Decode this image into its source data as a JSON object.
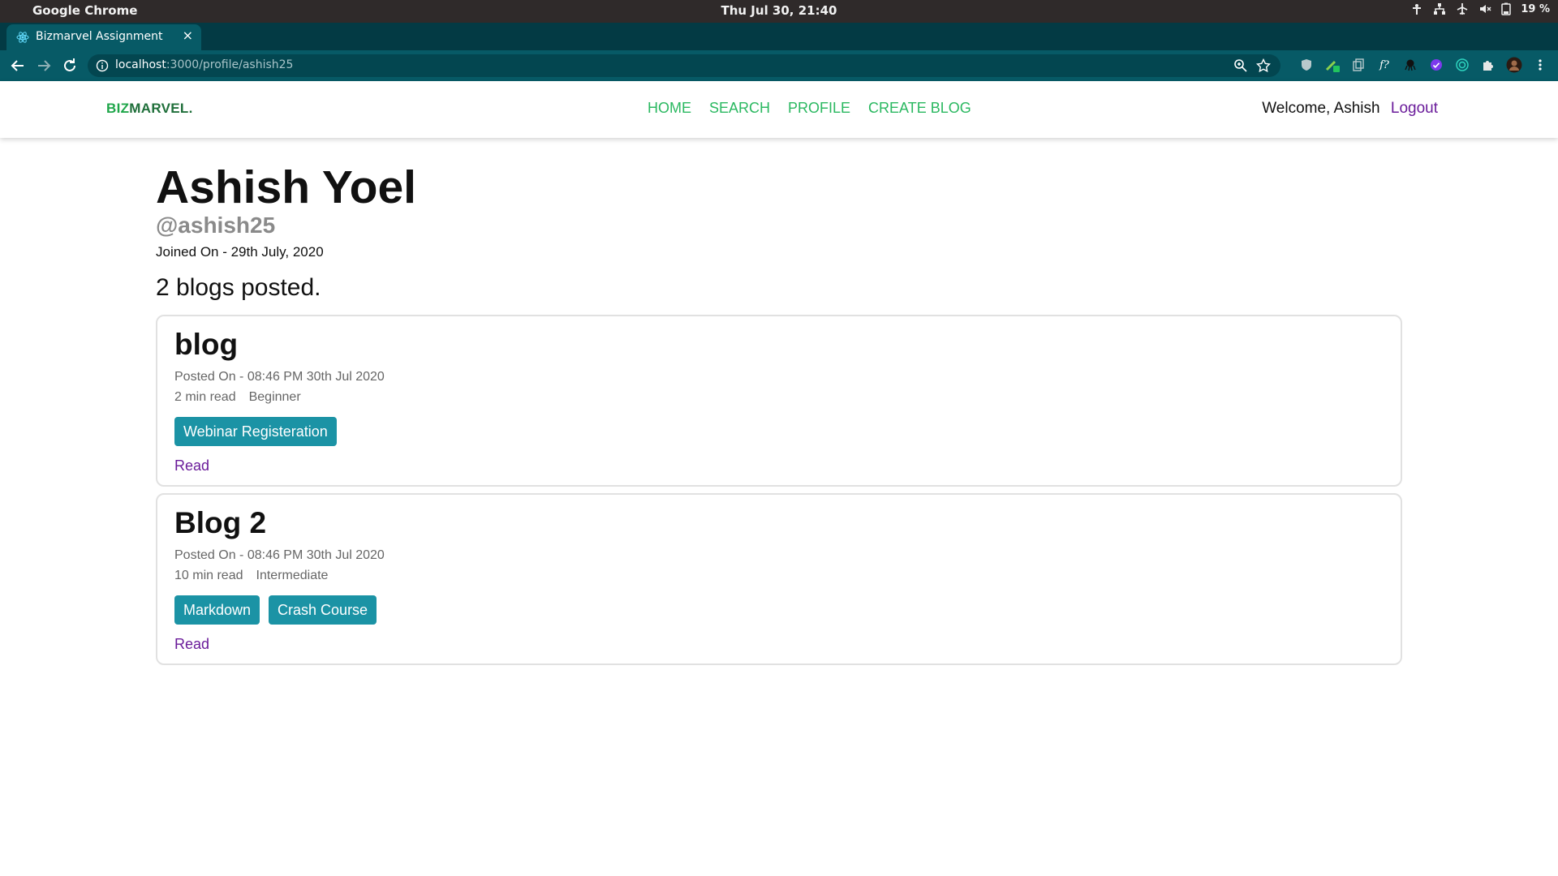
{
  "os": {
    "app_name": "Google Chrome",
    "clock": "Thu Jul 30, 21:40",
    "battery": "19 %"
  },
  "browser": {
    "tab_title": "Bizmarvel Assignment",
    "tab_close": "×",
    "new_tab": "+",
    "url_host": "localhost",
    "url_rest": ":3000/profile/ashish25"
  },
  "header": {
    "brand_biz": "BIZ",
    "brand_marvel": "MARVEL.",
    "nav": [
      "HOME",
      "SEARCH",
      "PROFILE",
      "CREATE BLOG"
    ],
    "welcome": "Welcome, Ashish",
    "logout": "Logout"
  },
  "profile": {
    "name": "Ashish Yoel",
    "handle": "@ashish25",
    "joined": "Joined On - 29th July, 2020",
    "blog_count": "2 blogs posted."
  },
  "blogs": [
    {
      "title": "blog",
      "posted": "Posted On - 08:46 PM 30th Jul 2020",
      "read_time": "2 min read",
      "level": "Beginner",
      "tags": [
        "Webinar Registeration"
      ],
      "read_label": "Read"
    },
    {
      "title": "Blog 2",
      "posted": "Posted On - 08:46 PM 30th Jul 2020",
      "read_time": "10 min read",
      "level": "Intermediate",
      "tags": [
        "Markdown",
        "Crash Course"
      ],
      "read_label": "Read"
    }
  ],
  "colors": {
    "accent_green": "#2ab860",
    "tag_teal": "#1b93a5",
    "link_purple": "#6a1b9a",
    "chrome_teal": "#075a66"
  }
}
